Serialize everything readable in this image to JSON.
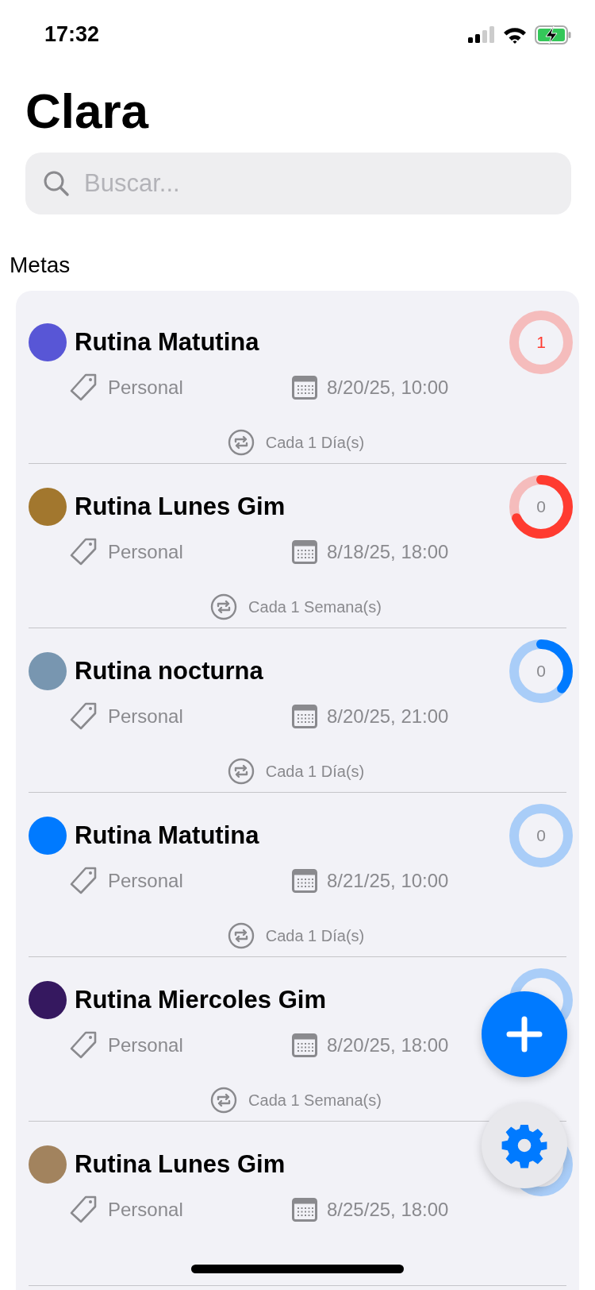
{
  "status_bar": {
    "time": "17:32"
  },
  "title": "Clara",
  "search": {
    "placeholder": "Buscar..."
  },
  "section_title": "Metas",
  "goals": [
    {
      "name": "Rutina Matutina",
      "color": "#5856d6",
      "category": "Personal",
      "date": "8/20/25, 10:00",
      "repeat": "Cada 1 Día(s)",
      "ring": {
        "color": "#f5bcbc",
        "count": "1",
        "achieved": true
      }
    },
    {
      "name": "Rutina Lunes Gim",
      "color": "#a2772e",
      "category": "Personal",
      "date": "8/18/25, 18:00",
      "repeat": "Cada 1 Semana(s)",
      "ring": {
        "color": "#f5bcbc",
        "arc": {
          "color": "#ff3b30",
          "kind": "long"
        },
        "count": "0",
        "achieved": false
      }
    },
    {
      "name": "Rutina nocturna",
      "color": "#7896b0",
      "category": "Personal",
      "date": "8/20/25, 21:00",
      "repeat": "Cada 1 Día(s)",
      "ring": {
        "color": "#a9cdf8",
        "arc": {
          "color": "#007aff",
          "kind": "short"
        },
        "count": "0",
        "achieved": false
      }
    },
    {
      "name": "Rutina Matutina",
      "color": "#007aff",
      "category": "Personal",
      "date": "8/21/25, 10:00",
      "repeat": "Cada 1 Día(s)",
      "ring": {
        "color": "#a9cdf8",
        "count": "0",
        "achieved": false
      }
    },
    {
      "name": "Rutina Miercoles Gim",
      "color": "#35185f",
      "category": "Personal",
      "date": "8/20/25, 18:00",
      "repeat": "Cada 1 Semana(s)",
      "ring": {
        "color": "#a9cdf8"
      }
    },
    {
      "name": "Rutina Lunes Gim",
      "color": "#a2835e",
      "category": "Personal",
      "date": "8/25/25, 18:00",
      "ring": {
        "color": "#a9cdf8"
      }
    }
  ]
}
